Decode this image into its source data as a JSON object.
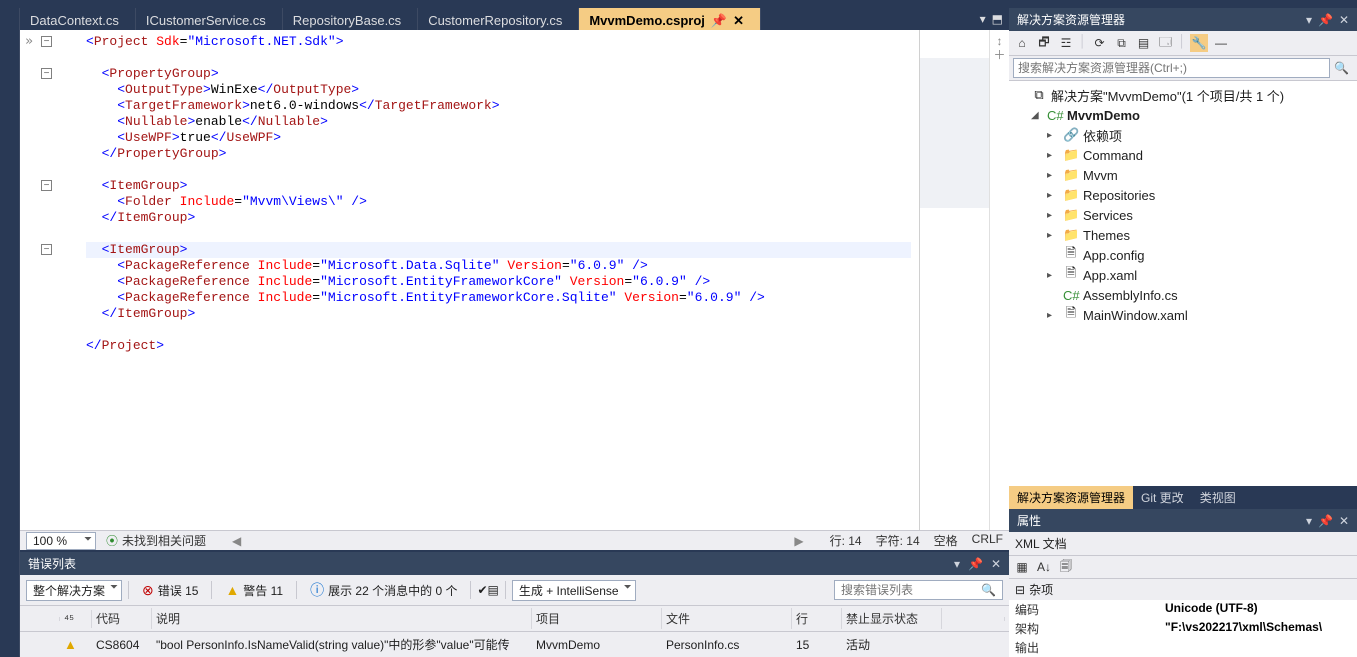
{
  "tabs": [
    {
      "label": "DataContext.cs",
      "active": false
    },
    {
      "label": "ICustomerService.cs",
      "active": false
    },
    {
      "label": "RepositoryBase.cs",
      "active": false
    },
    {
      "label": "CustomerRepository.cs",
      "active": false
    },
    {
      "label": "MvvmDemo.csproj",
      "active": true
    }
  ],
  "tab_tools": {
    "pin": "📌",
    "dropdown": "▾",
    "split": "⬒",
    "close": "✕",
    "add": "＋"
  },
  "code": {
    "lines": [
      {
        "raw": "<Project Sdk=\"Microsoft.NET.Sdk\">",
        "fold": "-"
      },
      {
        "raw": ""
      },
      {
        "raw": "  <PropertyGroup>",
        "fold": "-"
      },
      {
        "raw": "    <OutputType>WinExe</OutputType>"
      },
      {
        "raw": "    <TargetFramework>net6.0-windows</TargetFramework>"
      },
      {
        "raw": "    <Nullable>enable</Nullable>"
      },
      {
        "raw": "    <UseWPF>true</UseWPF>"
      },
      {
        "raw": "  </PropertyGroup>"
      },
      {
        "raw": ""
      },
      {
        "raw": "  <ItemGroup>",
        "fold": "-"
      },
      {
        "raw": "    <Folder Include=\"Mvvm\\Views\\\" />"
      },
      {
        "raw": "  </ItemGroup>"
      },
      {
        "raw": ""
      },
      {
        "raw": "  <ItemGroup>",
        "fold": "-",
        "cursor": true
      },
      {
        "raw": "    <PackageReference Include=\"Microsoft.Data.Sqlite\" Version=\"6.0.9\" />"
      },
      {
        "raw": "    <PackageReference Include=\"Microsoft.EntityFrameworkCore\" Version=\"6.0.9\" />"
      },
      {
        "raw": "    <PackageReference Include=\"Microsoft.EntityFrameworkCore.Sqlite\" Version=\"6.0.9\" />"
      },
      {
        "raw": "  </ItemGroup>"
      },
      {
        "raw": ""
      },
      {
        "raw": "</Project>"
      }
    ]
  },
  "editor_status": {
    "zoom": "100 %",
    "issues": "未找到相关问题",
    "line_lbl": "行: 14",
    "col_lbl": "字符: 14",
    "spaces": "空格",
    "crlf": "CRLF"
  },
  "error_panel": {
    "title": "错误列表",
    "scope": "整个解决方案",
    "err_label": "错误 15",
    "warn_label": "警告 11",
    "info_label": "展示 22 个消息中的 0 个",
    "build_combo": "生成 + IntelliSense",
    "search_ph": "搜索错误列表",
    "columns": {
      "code": "代码",
      "desc": "说明",
      "project": "项目",
      "file": "文件",
      "line": "行",
      "suppress": "禁止显示状态"
    },
    "row": {
      "icon": "⚠",
      "code": "CS8604",
      "desc": "\"bool PersonInfo.IsNameValid(string value)\"中的形参\"value\"可能传",
      "project": "MvvmDemo",
      "file": "PersonInfo.cs",
      "line": "15",
      "supp": "活动"
    }
  },
  "solution": {
    "panel_title": "解决方案资源管理器",
    "search_ph": "搜索解决方案资源管理器(Ctrl+;)",
    "root": "解决方案\"MvvmDemo\"(1 个项目/共 1 个)",
    "project": "MvvmDemo",
    "nodes": [
      {
        "icon": "🔗",
        "label": "依赖项",
        "exp": "▸",
        "cls": "refic"
      },
      {
        "icon": "📁",
        "label": "Command",
        "exp": "▸",
        "cls": "folder"
      },
      {
        "icon": "📁",
        "label": "Mvvm",
        "exp": "▸",
        "cls": "folder"
      },
      {
        "icon": "📁",
        "label": "Repositories",
        "exp": "▸",
        "cls": "folder"
      },
      {
        "icon": "📁",
        "label": "Services",
        "exp": "▸",
        "cls": "folder"
      },
      {
        "icon": "📁",
        "label": "Themes",
        "exp": "▸",
        "cls": "folder"
      },
      {
        "icon": "🗎",
        "label": "App.config",
        "exp": "",
        "cls": ""
      },
      {
        "icon": "🗎",
        "label": "App.xaml",
        "exp": "▸",
        "cls": ""
      },
      {
        "icon": "C#",
        "label": "AssemblyInfo.cs",
        "exp": "",
        "cls": "csfile"
      },
      {
        "icon": "🗎",
        "label": "MainWindow.xaml",
        "exp": "▸",
        "cls": ""
      }
    ],
    "tabs": [
      {
        "label": "解决方案资源管理器",
        "active": true
      },
      {
        "label": "Git 更改",
        "active": false
      },
      {
        "label": "类视图",
        "active": false
      }
    ]
  },
  "properties": {
    "title": "属性",
    "doc": "XML 文档",
    "category": "杂项",
    "rows": [
      {
        "k": "编码",
        "v": "Unicode (UTF-8)"
      },
      {
        "k": "架构",
        "v": "\"F:\\vs202217\\xml\\Schemas\\"
      },
      {
        "k": "输出",
        "v": ""
      }
    ]
  }
}
